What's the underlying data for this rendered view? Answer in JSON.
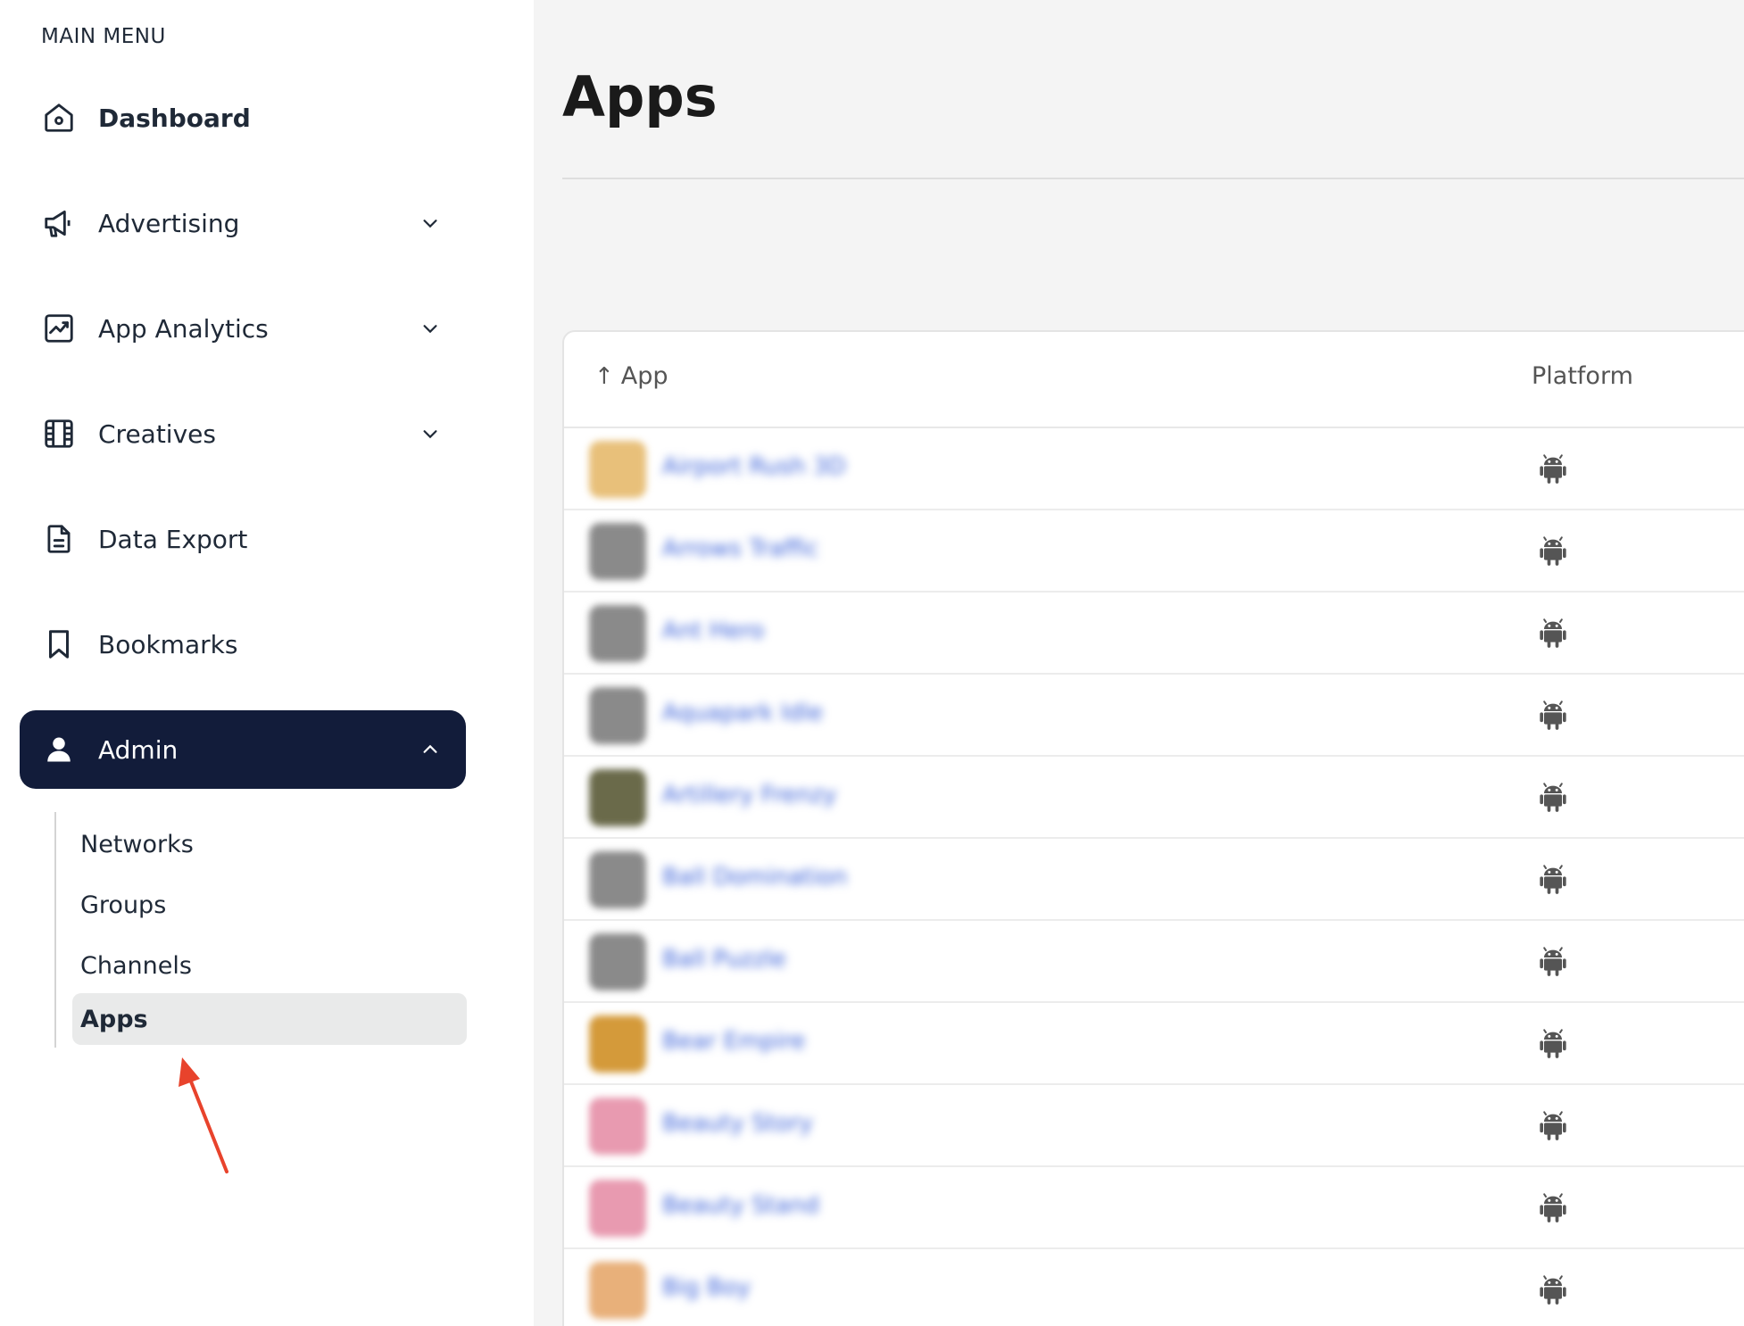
{
  "sidebar": {
    "heading": "MAIN MENU",
    "items": [
      {
        "label": "Dashboard",
        "icon": "home-icon"
      },
      {
        "label": "Advertising",
        "icon": "megaphone-icon"
      },
      {
        "label": "App Analytics",
        "icon": "chart-icon"
      },
      {
        "label": "Creatives",
        "icon": "film-icon"
      },
      {
        "label": "Data Export",
        "icon": "document-icon"
      },
      {
        "label": "Bookmarks",
        "icon": "bookmark-icon"
      },
      {
        "label": "Admin",
        "icon": "user-icon"
      }
    ],
    "admin_submenu": [
      {
        "label": "Networks"
      },
      {
        "label": "Groups"
      },
      {
        "label": "Channels"
      },
      {
        "label": "Apps"
      }
    ],
    "active_color": "#121c3a"
  },
  "main": {
    "title": "Apps",
    "table": {
      "columns": [
        "App",
        "Platform"
      ],
      "sort_indicator": "↑",
      "rows": [
        {
          "name": "Airport Rush 3D",
          "platform": "android-icon",
          "thumb_color": "#e8c07a"
        },
        {
          "name": "Arrows Traffic",
          "platform": "android-icon",
          "thumb_color": "#8a8a8a"
        },
        {
          "name": "Ant Hero",
          "platform": "android-icon",
          "thumb_color": "#8a8a8a"
        },
        {
          "name": "Aquapark Idle",
          "platform": "android-icon",
          "thumb_color": "#8a8a8a"
        },
        {
          "name": "Artillery Frenzy",
          "platform": "android-icon",
          "thumb_color": "#6a6a4a"
        },
        {
          "name": "Ball Domination",
          "platform": "android-icon",
          "thumb_color": "#8a8a8a"
        },
        {
          "name": "Ball Puzzle",
          "platform": "android-icon",
          "thumb_color": "#8a8a8a"
        },
        {
          "name": "Bear Empire",
          "platform": "android-icon",
          "thumb_color": "#d49a3a"
        },
        {
          "name": "Beauty Story",
          "platform": "android-icon",
          "thumb_color": "#e89ab0"
        },
        {
          "name": "Beauty Stand",
          "platform": "android-icon",
          "thumb_color": "#e89ab0"
        },
        {
          "name": "Big Boy",
          "platform": "android-icon",
          "thumb_color": "#e8b07a"
        }
      ]
    }
  }
}
